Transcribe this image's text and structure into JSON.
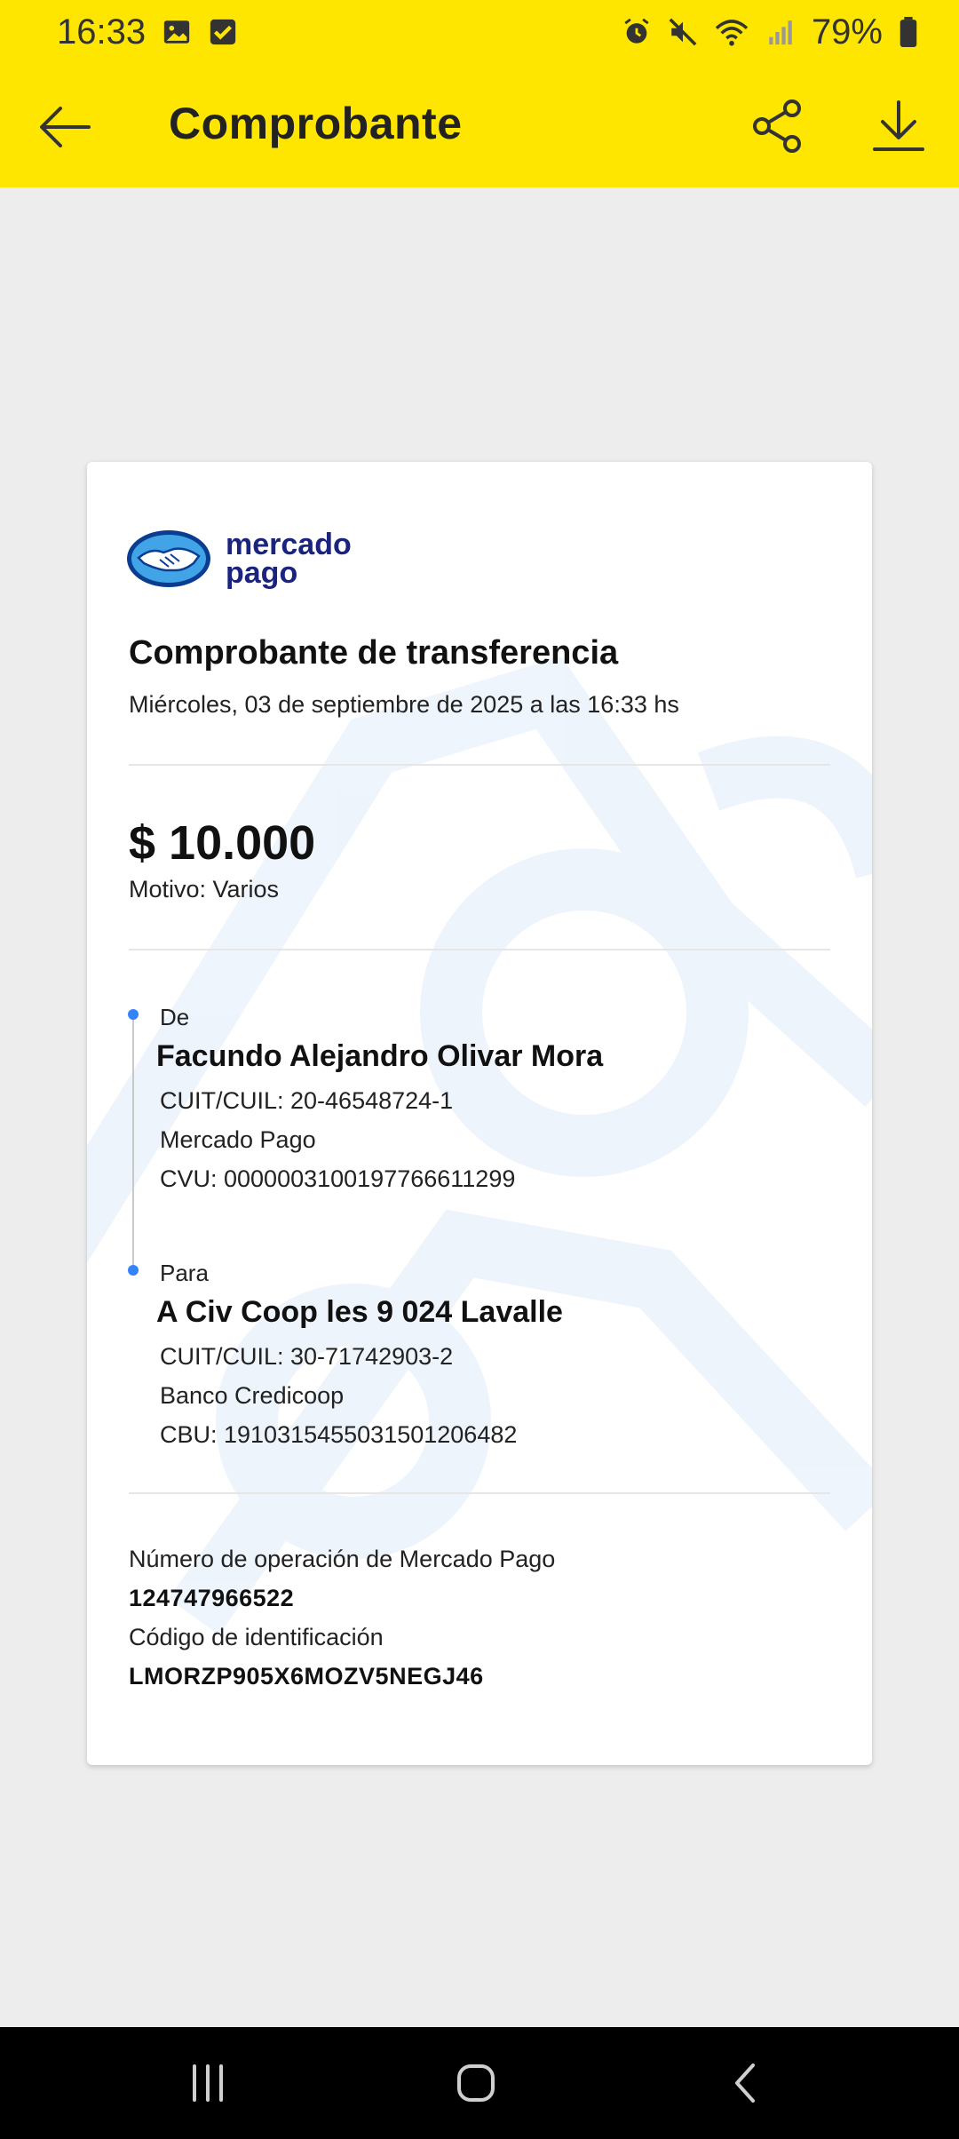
{
  "status_bar": {
    "time": "16:33",
    "battery": "79%",
    "left_icons": [
      "image-icon",
      "check-square-icon"
    ],
    "right_icons": [
      "alarm-icon",
      "mute-icon",
      "wifi-icon",
      "signal-icon",
      "battery-icon"
    ]
  },
  "app_bar": {
    "title": "Comprobante",
    "background": "#ffe600"
  },
  "receipt": {
    "logo_text": "mercado pago",
    "title": "Comprobante de transferencia",
    "date": "Miércoles, 03 de septiembre de 2025 a las 16:33 hs",
    "amount": "$ 10.000",
    "motivo": "Motivo: Varios",
    "from": {
      "label": "De",
      "name": "Facundo Alejandro Olivar Mora",
      "cuit": "CUIT/CUIL: 20-46548724-1",
      "entity": "Mercado Pago",
      "account": "CVU: 0000003100197766611299"
    },
    "to": {
      "label": "Para",
      "name": "A Civ Coop les 9 024 Lavalle",
      "cuit": "CUIT/CUIL: 30-71742903-2",
      "entity": "Banco Credicoop",
      "account": "CBU: 1910315455031501206482"
    },
    "operation_label": "Número de operación de Mercado Pago",
    "operation_number": "124747966522",
    "id_label": "Código de identificación",
    "id_code": "LMORZP905X6MOZV5NEGJ46"
  },
  "colors": {
    "accent_blue": "#3483fa",
    "brand_navy": "#1a237e"
  }
}
